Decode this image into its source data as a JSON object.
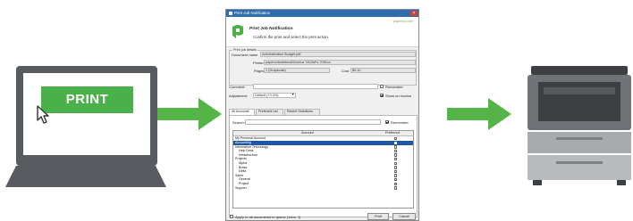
{
  "laptop": {
    "print_label": "PRINT"
  },
  "dialog": {
    "window_title": "Print Job Notification",
    "close_glyph": "×",
    "header_title": "Print Job Notification",
    "header_subtitle": "Confirm the print and select the print action",
    "brand": "papercut.com",
    "details_group_label": "Print job details",
    "document_name_label": "Document name",
    "document_name_value": "Administration Budget.pdf",
    "printer_label": "Printer",
    "printer_value": "papercutnotebook\\Konica 7ACfaFo-7091cc",
    "pages_label": "Pages",
    "pages_value": "1 (Grayscale)",
    "cost_label": "Cost",
    "cost_value": "$0.10",
    "comment_label": "Comment:",
    "remember_label": "Remember",
    "adjustment_label": "Adjustment:",
    "adjustment_value": "Default (+0.0%)",
    "show_on_invoice_label": "Show on invoice",
    "tabs": [
      {
        "label": "All Accounts",
        "active": true
      },
      {
        "label": "Preferred List",
        "active": false
      },
      {
        "label": "Recent Selections",
        "active": false
      }
    ],
    "search_label": "Search:",
    "search_remember_label": "Remember",
    "table_headers": {
      "account": "Account",
      "preferred": "Preferred"
    },
    "accounts": [
      {
        "name": "My Personal Account",
        "indent": 0,
        "selected": false,
        "preferred": false
      },
      {
        "name": "Accounting",
        "indent": 0,
        "selected": true,
        "preferred": false
      },
      {
        "name": "Information Technology",
        "indent": 0,
        "selected": false,
        "preferred": false
      },
      {
        "name": "Help Desk",
        "indent": 1,
        "selected": false,
        "preferred": false
      },
      {
        "name": "Infrastructure",
        "indent": 1,
        "selected": false,
        "preferred": false
      },
      {
        "name": "Projects",
        "indent": 0,
        "selected": false,
        "preferred": false
      },
      {
        "name": "Alpha",
        "indent": 1,
        "selected": false,
        "preferred": false
      },
      {
        "name": "Bravo",
        "indent": 1,
        "selected": false,
        "preferred": false
      },
      {
        "name": "Delta",
        "indent": 1,
        "selected": false,
        "preferred": false
      },
      {
        "name": "Sales",
        "indent": 0,
        "selected": false,
        "preferred": false
      },
      {
        "name": "General",
        "indent": 1,
        "selected": false,
        "preferred": false
      },
      {
        "name": "Project",
        "indent": 1,
        "selected": false,
        "preferred": false
      },
      {
        "name": "Support",
        "indent": 0,
        "selected": false,
        "preferred": false
      }
    ],
    "apply_all_label": "Apply to all documents in queue (Jobs: 1)",
    "print_button": "Print",
    "cancel_button": "Cancel"
  },
  "colors": {
    "accent_green": "#4ab04a",
    "arrow_green": "#55b447",
    "laptop_gray": "#585b5f",
    "printer_dark": "#3d3f42",
    "printer_mid": "#7c7f83",
    "printer_light": "#a8abae",
    "selection_blue": "#1f56a6"
  },
  "icons": {
    "cursor": "mouse-pointer-icon",
    "logo": "papercut-logo-icon",
    "printer": "printer-icon",
    "arrow": "arrow-right-icon"
  }
}
